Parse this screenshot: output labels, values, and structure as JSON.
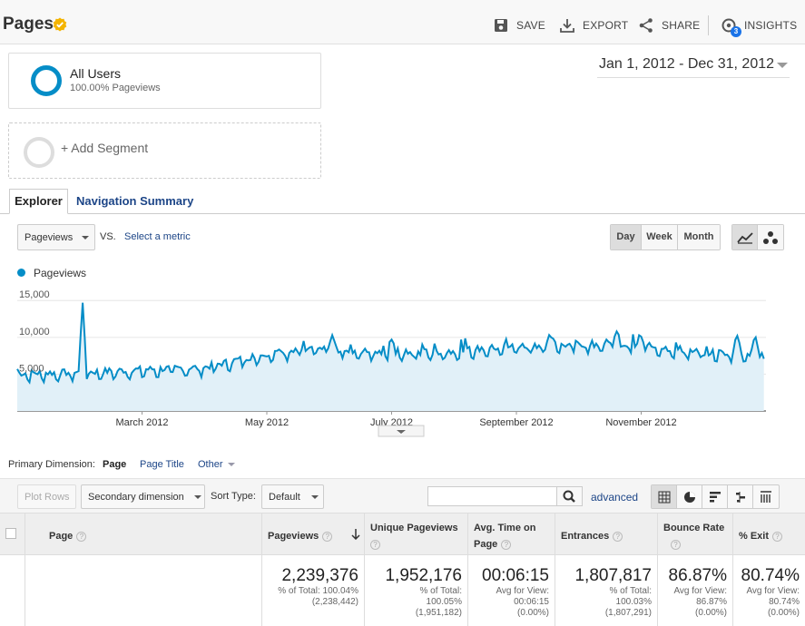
{
  "header": {
    "title": "Pages",
    "save": "SAVE",
    "export": "EXPORT",
    "share": "SHARE",
    "insights": "INSIGHTS",
    "insights_count": "3"
  },
  "segments": {
    "all_users": {
      "name": "All Users",
      "sub": "100.00% Pageviews"
    },
    "add_label": "+ Add Segment"
  },
  "date_range": "Jan 1, 2012 - Dec 31, 2012",
  "tabs": {
    "explorer": "Explorer",
    "nav_summary": "Navigation Summary"
  },
  "metric": {
    "selected": "Pageviews",
    "vs": "VS.",
    "select_link": "Select a metric"
  },
  "granularity": {
    "day": "Day",
    "week": "Week",
    "month": "Month",
    "active": "Day"
  },
  "colors": {
    "accent": "#058dc7",
    "link": "#1c4587",
    "area": "#e1f0f8"
  },
  "chart_data": {
    "type": "area",
    "series": [
      {
        "name": "Pageviews"
      }
    ],
    "y_ticks": [
      "15,000",
      "10,000",
      "5,000"
    ],
    "y_tick_values": [
      15000,
      10000,
      5000
    ],
    "ylim": [
      0,
      17000
    ],
    "x_tick_labels": [
      "March 2012",
      "May 2012",
      "July 2012",
      "September 2012",
      "November 2012"
    ],
    "x_tick_months": [
      2,
      4,
      6,
      8,
      10
    ],
    "x_range_months": [
      0,
      12
    ],
    "monthly_baseline": [
      4900,
      5000,
      5400,
      5700,
      7600,
      8200,
      7600,
      7900,
      8600,
      8900,
      8700,
      7700
    ],
    "peaks": [
      {
        "month": 1.05,
        "value": 14700
      },
      {
        "month": 5.05,
        "value": 10300
      },
      {
        "month": 6.0,
        "value": 9700
      },
      {
        "month": 8.55,
        "value": 10000
      },
      {
        "month": 9.6,
        "value": 10800
      },
      {
        "month": 10.0,
        "value": 10100
      },
      {
        "month": 11.55,
        "value": 10200
      },
      {
        "month": 11.85,
        "value": 10000
      }
    ],
    "end_value": 7100,
    "grid": true,
    "legend": "top-left"
  },
  "primary_dimension": {
    "label": "Primary Dimension:",
    "page": "Page",
    "page_title": "Page Title",
    "other": "Other"
  },
  "toolbar": {
    "plot_rows": "Plot Rows",
    "secondary_dimension": "Secondary dimension",
    "sort_type_label": "Sort Type:",
    "sort_type_value": "Default",
    "search_placeholder": "",
    "advanced": "advanced"
  },
  "table": {
    "headers": {
      "page": "Page",
      "pageviews": "Pageviews",
      "unique_pageviews": "Unique Pageviews",
      "avg_time": "Avg. Time on Page",
      "entrances": "Entrances",
      "bounce_rate": "Bounce Rate",
      "exit": "% Exit"
    },
    "totals": {
      "pageviews": {
        "value": "2,239,376",
        "line1": "% of Total: 100.04%",
        "line2": "(2,238,442)"
      },
      "unique_pageviews": {
        "value": "1,952,176",
        "line1": "% of Total:",
        "line2": "100.05%",
        "line3": "(1,951,182)"
      },
      "avg_time": {
        "value": "00:06:15",
        "line1": "Avg for View:",
        "line2": "00:06:15",
        "line3": "(0.00%)"
      },
      "entrances": {
        "value": "1,807,817",
        "line1": "% of Total:",
        "line2": "100.03%",
        "line3": "(1,807,291)"
      },
      "bounce_rate": {
        "value": "86.87%",
        "line1": "Avg for View:",
        "line2": "86.87%",
        "line3": "(0.00%)"
      },
      "exit": {
        "value": "80.74%",
        "line1": "Avg for View:",
        "line2": "80.74%",
        "line3": "(0.00%)"
      }
    }
  }
}
